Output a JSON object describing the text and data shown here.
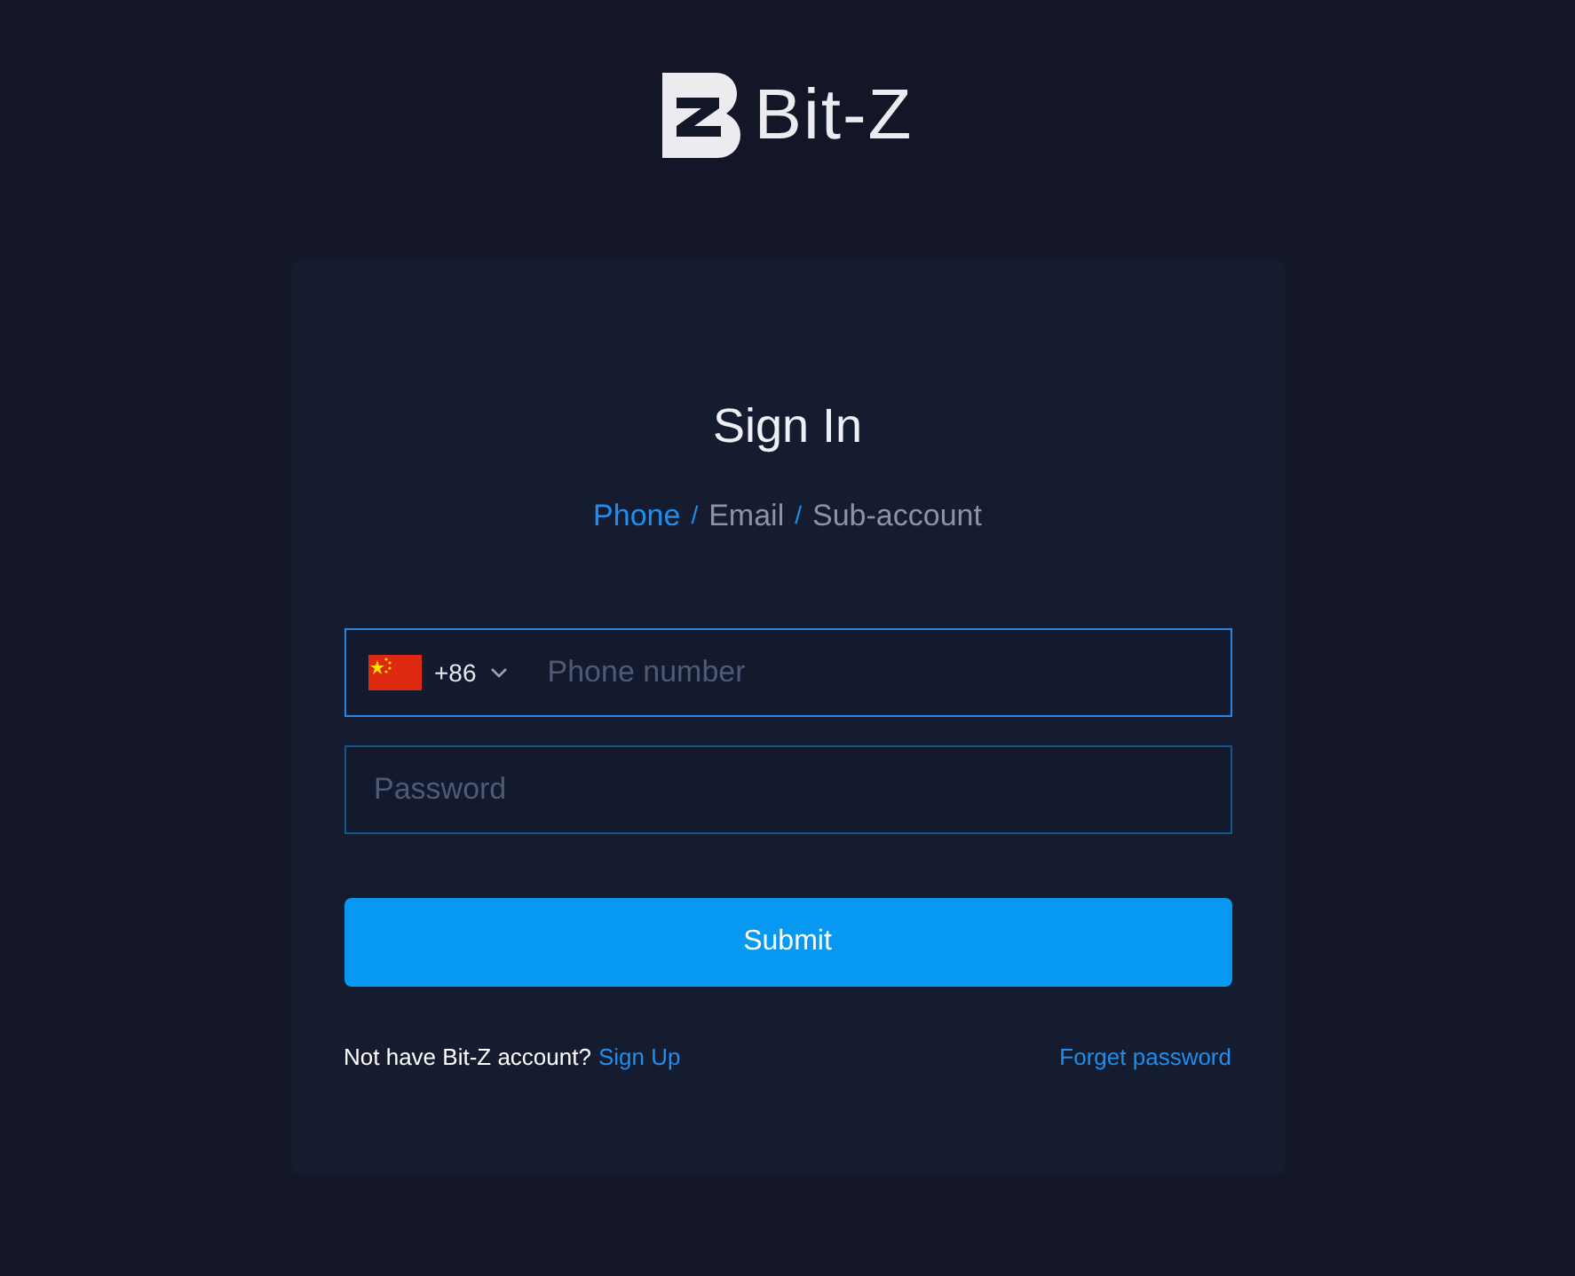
{
  "logo": {
    "text": "Bit-Z"
  },
  "form": {
    "title": "Sign In",
    "tab_separator": "/",
    "tabs": [
      {
        "label": "Phone",
        "selected": true
      },
      {
        "label": "Email",
        "selected": false
      },
      {
        "label": "Sub-account",
        "selected": false
      }
    ],
    "country_code": "+86",
    "phone": {
      "placeholder": "Phone number",
      "focused": true
    },
    "password": {
      "placeholder": "Password",
      "focused": false
    },
    "submit": "Submit",
    "signup_prompt": "Not have Bit-Z account?",
    "signup_link": "Sign Up",
    "forgot_link": "Forget password"
  }
}
